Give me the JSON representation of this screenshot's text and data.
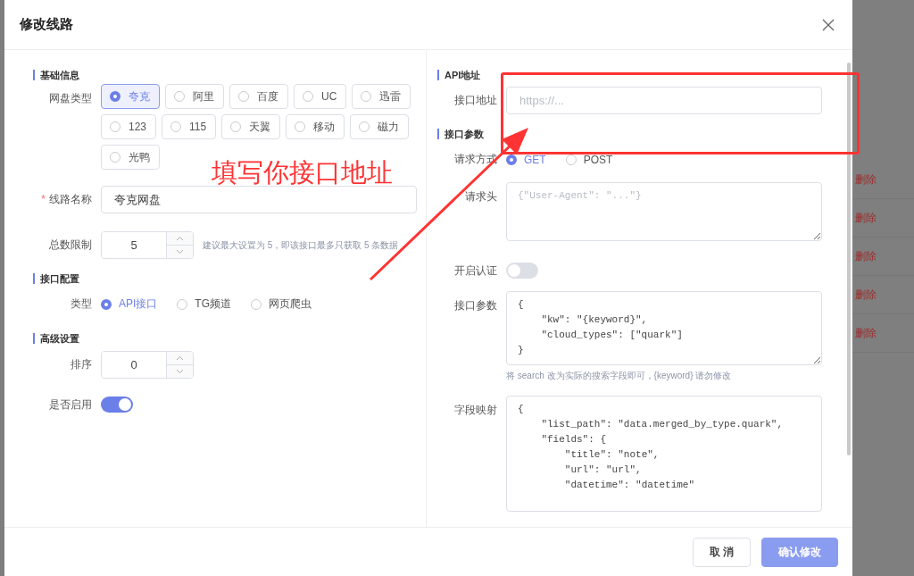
{
  "dialog": {
    "title": "修改线路"
  },
  "basic": {
    "heading": "基础信息",
    "disk_label": "网盘类型",
    "disk_types": [
      {
        "label": "夸克",
        "selected": true
      },
      {
        "label": "阿里",
        "selected": false
      },
      {
        "label": "百度",
        "selected": false
      },
      {
        "label": "UC",
        "selected": false
      },
      {
        "label": "迅雷",
        "selected": false
      },
      {
        "label": "123",
        "selected": false
      },
      {
        "label": "115",
        "selected": false
      },
      {
        "label": "天翼",
        "selected": false
      },
      {
        "label": "移动",
        "selected": false
      },
      {
        "label": "磁力",
        "selected": false
      },
      {
        "label": "光鸭",
        "selected": false
      }
    ],
    "name_label": "线路名称",
    "name_required_mark": "*",
    "name_value": "夸克网盘",
    "limit_label": "总数限制",
    "limit_value": "5",
    "limit_hint": "建议最大设置为 5，即该接口最多只获取 5 条数据"
  },
  "interface": {
    "heading": "接口配置",
    "type_label": "类型",
    "types": [
      {
        "label": "API接口",
        "selected": true
      },
      {
        "label": "TG频道",
        "selected": false
      },
      {
        "label": "网页爬虫",
        "selected": false
      }
    ]
  },
  "advanced": {
    "heading": "高级设置",
    "order_label": "排序",
    "order_value": "0",
    "enabled_label": "是否启用",
    "enabled": true
  },
  "api": {
    "heading": "API地址",
    "url_label": "接口地址",
    "url_placeholder": "https://..."
  },
  "params": {
    "heading": "接口参数",
    "method_label": "请求方式",
    "methods": [
      {
        "label": "GET",
        "selected": true
      },
      {
        "label": "POST",
        "selected": false
      }
    ],
    "headers_label": "请求头",
    "headers_placeholder": "{\"User-Agent\": \"...\"}",
    "auth_label": "开启认证",
    "auth": false,
    "body_label": "接口参数",
    "body_value": "{\n    \"kw\": \"{keyword}\",\n    \"cloud_types\": [\"quark\"]\n}",
    "body_hint": "将 search 改为实际的搜索字段即可，{keyword} 请勿修改",
    "mapping_label": "字段映射",
    "mapping_value": "{\n    \"list_path\": \"data.merged_by_type.quark\",\n    \"fields\": {\n        \"title\": \"note\",\n        \"url\": \"url\",\n        \"datetime\": \"datetime\""
  },
  "buttons": [
    {
      "label": "取 消",
      "kind": "secondary"
    },
    {
      "label": "确认修改",
      "kind": "primary"
    }
  ],
  "background_actions": [
    "删除",
    "删除",
    "删除",
    "删除",
    "删除"
  ],
  "annotation": {
    "text": "填写你接口地址"
  }
}
